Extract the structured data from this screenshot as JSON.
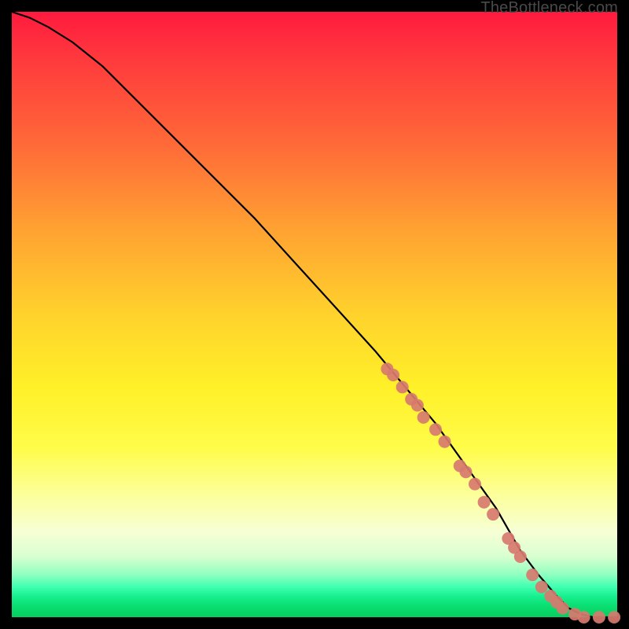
{
  "watermark": "TheBottleneck.com",
  "chart_data": {
    "type": "line",
    "title": "",
    "xlabel": "",
    "ylabel": "",
    "xlim": [
      0,
      100
    ],
    "ylim": [
      0,
      100
    ],
    "grid": false,
    "legend": false,
    "background": "vertical gradient red→orange→yellow→green (bottleneck heatmap)",
    "series": [
      {
        "name": "bottleneck-curve",
        "color": "#000000",
        "x": [
          0,
          3,
          6,
          10,
          15,
          20,
          30,
          40,
          50,
          60,
          65,
          70,
          75,
          80,
          84,
          87,
          90,
          92,
          94,
          96,
          98,
          100
        ],
        "y": [
          100,
          99,
          97.5,
          95,
          91,
          86,
          76,
          66,
          55,
          44,
          38,
          32,
          25,
          18,
          11,
          7,
          3.5,
          1.5,
          0.5,
          0,
          0,
          0
        ]
      }
    ],
    "markers": {
      "name": "highlighted-points",
      "color": "#d77a6f",
      "shape": "circle",
      "radius_px": 8,
      "points": [
        {
          "x": 62,
          "y": 41
        },
        {
          "x": 63,
          "y": 40
        },
        {
          "x": 64.5,
          "y": 38
        },
        {
          "x": 66,
          "y": 36
        },
        {
          "x": 67,
          "y": 35
        },
        {
          "x": 68,
          "y": 33
        },
        {
          "x": 70,
          "y": 31
        },
        {
          "x": 71.5,
          "y": 29
        },
        {
          "x": 74,
          "y": 25
        },
        {
          "x": 75,
          "y": 24
        },
        {
          "x": 76.5,
          "y": 22
        },
        {
          "x": 78,
          "y": 19
        },
        {
          "x": 79.5,
          "y": 17
        },
        {
          "x": 82,
          "y": 13
        },
        {
          "x": 83,
          "y": 11.5
        },
        {
          "x": 84,
          "y": 10
        },
        {
          "x": 86,
          "y": 7
        },
        {
          "x": 87.5,
          "y": 5
        },
        {
          "x": 89,
          "y": 3.5
        },
        {
          "x": 90,
          "y": 2.5
        },
        {
          "x": 91,
          "y": 1.5
        },
        {
          "x": 93,
          "y": 0.5
        },
        {
          "x": 94.5,
          "y": 0
        },
        {
          "x": 97,
          "y": 0
        },
        {
          "x": 99.5,
          "y": 0
        }
      ]
    }
  }
}
